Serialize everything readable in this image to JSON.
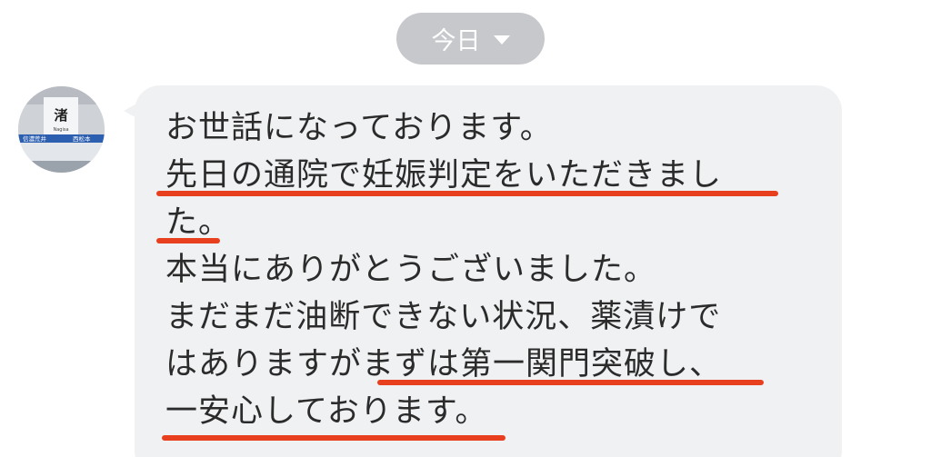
{
  "header": {
    "date_label": "今日"
  },
  "message": {
    "sender_avatar": {
      "station_name": "渚",
      "station_romaji": "Nagisa",
      "prev_station": "信濃荒井",
      "next_station": "西松本"
    },
    "lines": [
      "お世話になっております。",
      "先日の通院で妊娠判定をいただきまし",
      "た。",
      "本当にありがとうございました。",
      "まだまだ油断できない状況、薬漬けで",
      "はありますがまずは第一関門突破し、",
      "一安心しております。"
    ]
  },
  "colors": {
    "bubble": "#f0f1f3",
    "date_pill": "#c7c8cc",
    "highlight_underline": "#e8401f",
    "text": "#2b2b2b"
  }
}
